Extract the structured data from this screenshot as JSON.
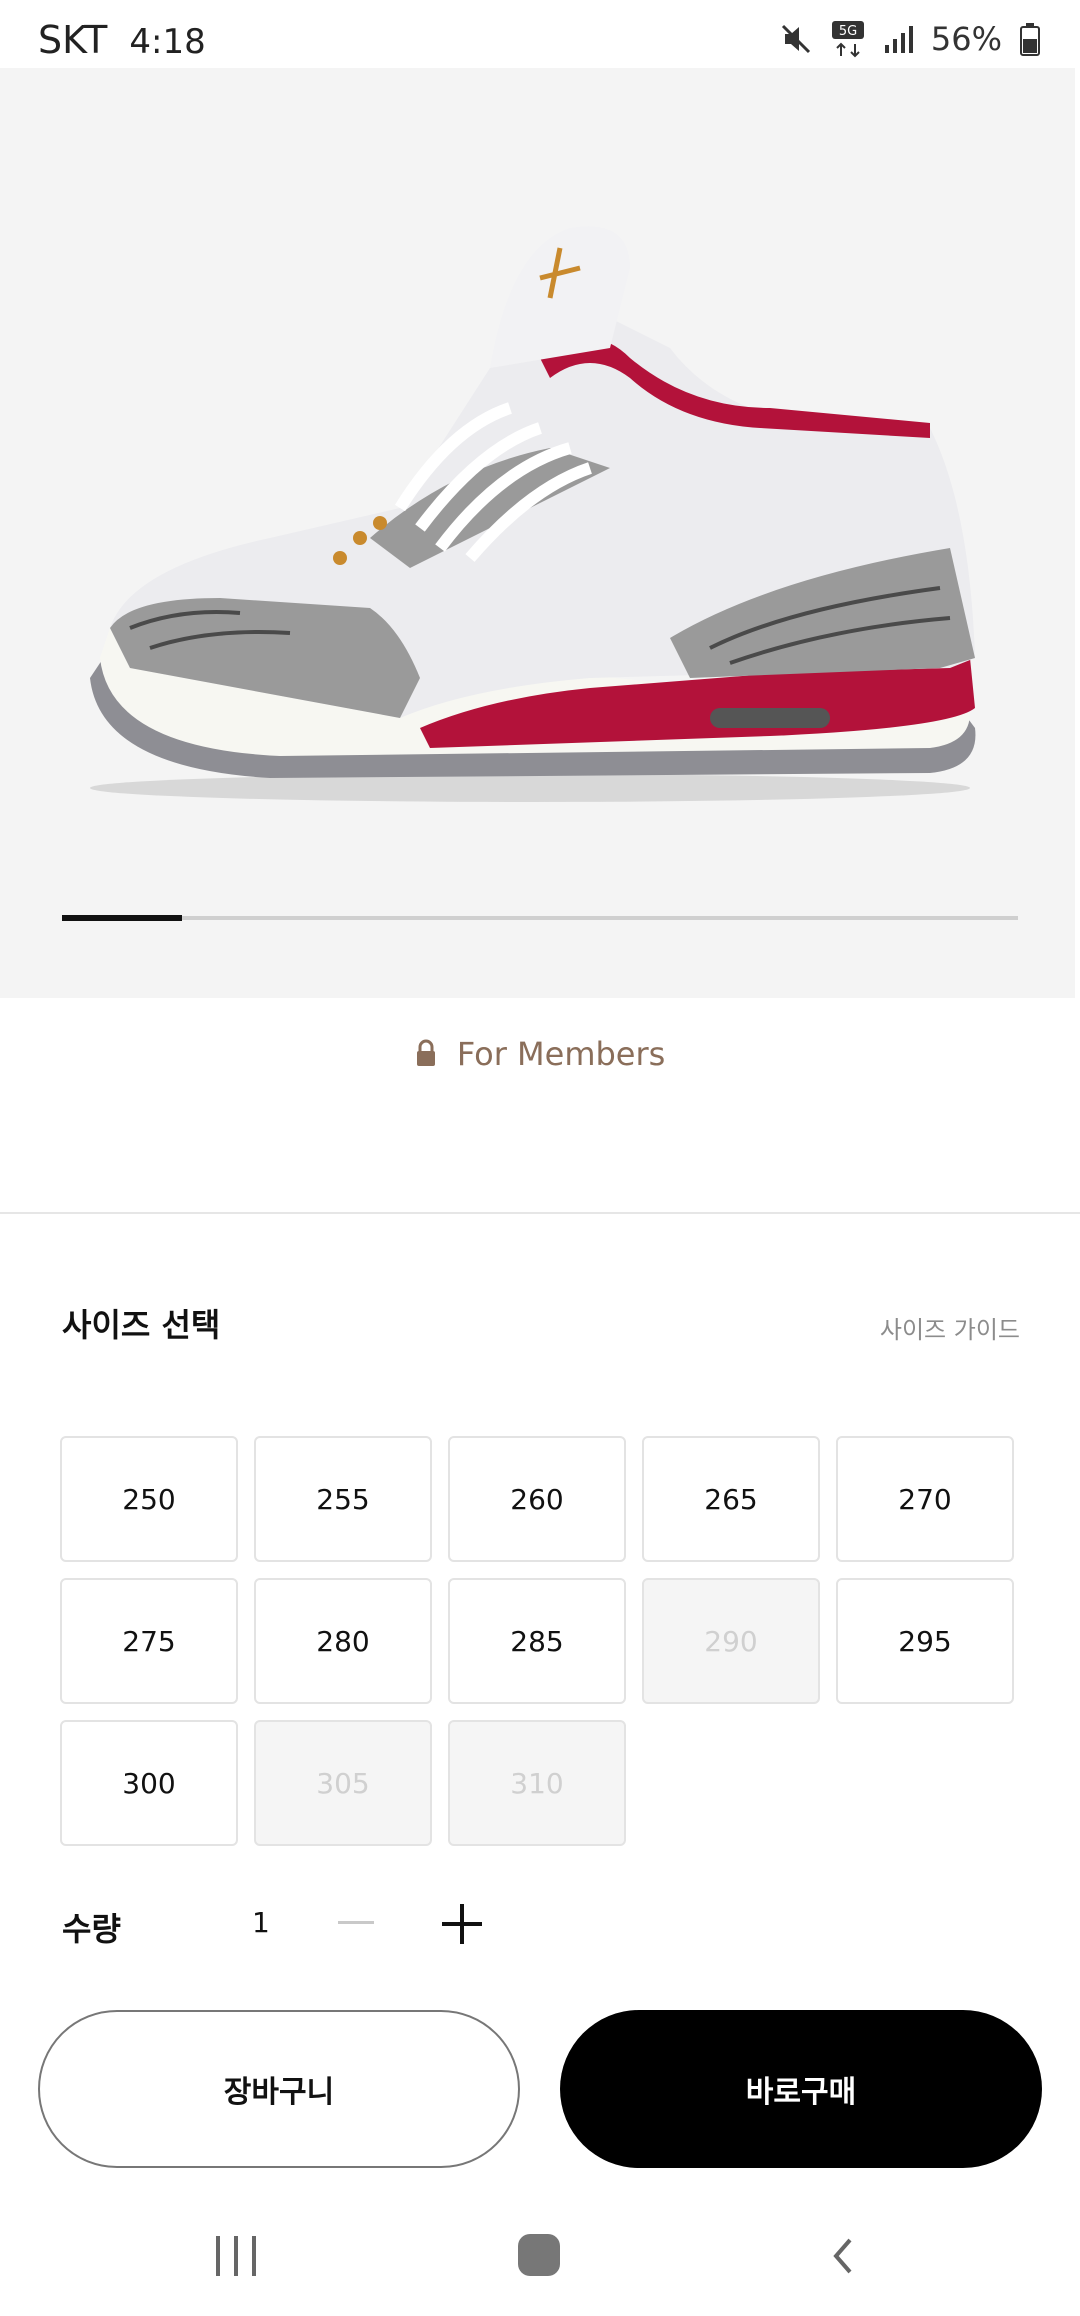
{
  "status_bar": {
    "carrier": "SKT",
    "time": "4:18",
    "network": "5G",
    "battery": "56%",
    "icons": [
      "mute-icon",
      "5g-icon",
      "signal-icon",
      "battery-icon"
    ]
  },
  "product": {
    "image": "sneaker-red-white-cement",
    "gallery_progress": 0.125
  },
  "members": {
    "label": "For Members",
    "icon": "lock-icon"
  },
  "size_section": {
    "title": "사이즈 선택",
    "guide_link": "사이즈 가이드",
    "sizes": [
      {
        "label": "250",
        "available": true
      },
      {
        "label": "255",
        "available": true
      },
      {
        "label": "260",
        "available": true
      },
      {
        "label": "265",
        "available": true
      },
      {
        "label": "270",
        "available": true
      },
      {
        "label": "275",
        "available": true
      },
      {
        "label": "280",
        "available": true
      },
      {
        "label": "285",
        "available": true
      },
      {
        "label": "290",
        "available": false
      },
      {
        "label": "295",
        "available": true
      },
      {
        "label": "300",
        "available": true
      },
      {
        "label": "305",
        "available": false
      },
      {
        "label": "310",
        "available": false
      }
    ]
  },
  "quantity": {
    "label": "수량",
    "value": "1"
  },
  "actions": {
    "cart_label": "장바구니",
    "buy_label": "바로구매"
  },
  "colors": {
    "accent": "#000000",
    "members_text": "#8a6e5a",
    "shoe_red": "#b3123a"
  }
}
